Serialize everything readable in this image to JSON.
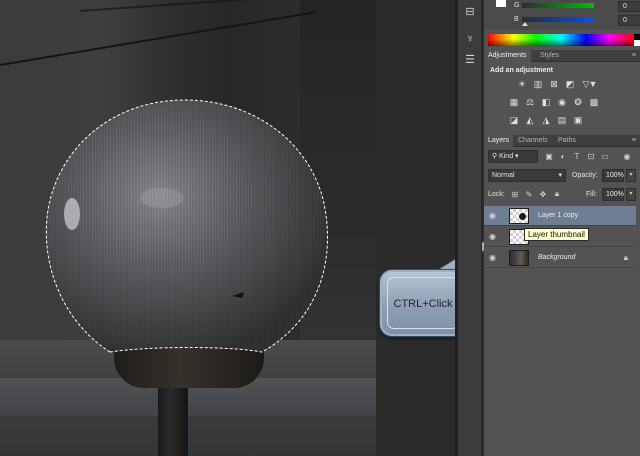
{
  "color_panel": {
    "channels": [
      {
        "name": "G",
        "value": "0",
        "color": "#00a000"
      },
      {
        "name": "B",
        "value": "0",
        "color": "#0050ff"
      }
    ]
  },
  "adjustments": {
    "tabs": [
      {
        "label": "Adjustments",
        "active": true
      },
      {
        "label": "Styles",
        "active": false
      }
    ],
    "heading": "Add an adjustment",
    "row1_icons": [
      "brightness-contrast-icon",
      "levels-icon",
      "curves-icon",
      "exposure-icon",
      "vibrance-icon",
      "triangle-icon"
    ],
    "row2_icons": [
      "hue-saturation-icon",
      "color-balance-icon",
      "black-white-icon",
      "photo-filter-icon",
      "channel-mixer-icon",
      "color-lookup-icon"
    ],
    "row3_icons": [
      "invert-icon",
      "posterize-icon",
      "threshold-icon",
      "gradient-map-icon",
      "selective-color-icon"
    ]
  },
  "layers_panel": {
    "tabs": [
      {
        "label": "Layers",
        "active": true
      },
      {
        "label": "Channels",
        "active": false
      },
      {
        "label": "Paths",
        "active": false
      }
    ],
    "filter_kind": "Kind",
    "blend_mode": "Normal",
    "opacity_label": "Opacity:",
    "opacity_value": "100%",
    "lock_label": "Lock:",
    "fill_label": "Fill:",
    "fill_value": "100%",
    "layers": [
      {
        "name": "Layer 1 copy",
        "selected": true,
        "italic": false
      },
      {
        "name": "",
        "selected": false,
        "italic": false
      },
      {
        "name": "Background",
        "selected": false,
        "italic": true
      }
    ]
  },
  "tooltip": "Layer thumbnail",
  "callout": "CTRL+Click"
}
